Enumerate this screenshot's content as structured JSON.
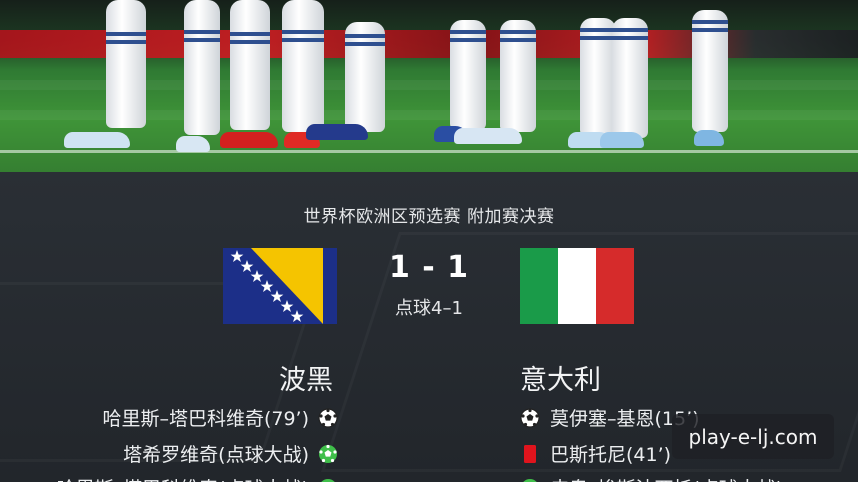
{
  "hero": {
    "alt_subject": "players-legs-on-pitch"
  },
  "match": {
    "competition": "世界杯欧洲区预选赛 附加赛决赛",
    "score": "1 - 1",
    "penalties": "点球4–1",
    "home_team": "波黑",
    "away_team": "意大利",
    "home_flag": "bosnia-herzegovina-flag",
    "away_flag": "italy-flag"
  },
  "events": {
    "home": [
      {
        "text": "哈里斯–塔巴科维奇(79’)",
        "icon": "football-icon"
      },
      {
        "text": "塔希罗维奇(点球大战)",
        "icon": "penalty-scored-icon"
      },
      {
        "text": "哈里斯–塔巴科维奇(点球大战)",
        "icon": "penalty-scored-icon"
      }
    ],
    "away": [
      {
        "text": "莫伊塞–基恩(15’)",
        "icon": "football-icon"
      },
      {
        "text": "巴斯托尼(41’)",
        "icon": "red-card-icon"
      },
      {
        "text": "皮奥–埃斯波西托(点球大战)",
        "icon": "penalty-scored-icon"
      }
    ]
  },
  "watermark": "play-e-lj.com",
  "colors": {
    "background": "#24282d",
    "red_card": "#e0141d",
    "penalty_green": "#3fbf4a",
    "bih_blue": "#1c2f88",
    "bih_yellow": "#f5c400",
    "ita_green": "#1a9b49",
    "ita_white": "#ffffff",
    "ita_red": "#d62b2b"
  }
}
